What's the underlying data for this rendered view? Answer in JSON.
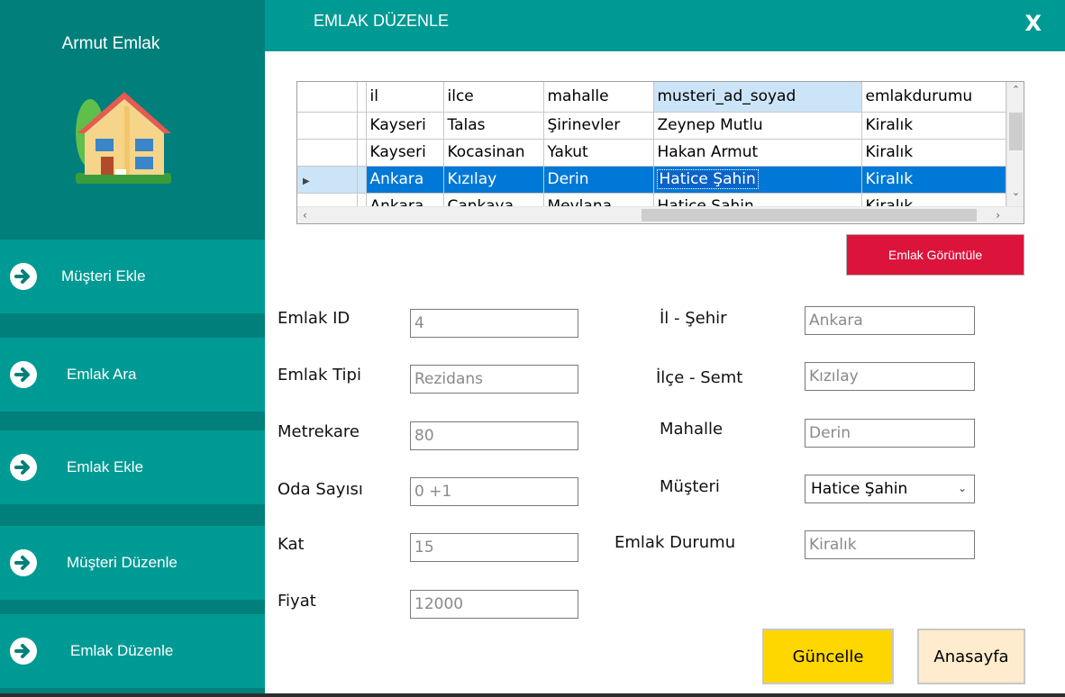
{
  "sidebar": {
    "brand": "Armut Emlak",
    "items": [
      {
        "label": "Müşteri Ekle"
      },
      {
        "label": "Emlak Ara"
      },
      {
        "label": "Emlak Ekle"
      },
      {
        "label": "Müşteri Düzenle"
      },
      {
        "label": "Emlak Düzenle"
      }
    ]
  },
  "header": {
    "title": "EMLAK DÜZENLE",
    "close": "X"
  },
  "grid": {
    "columns": [
      "il",
      "ilce",
      "mahalle",
      "musteri_ad_soyad",
      "emlakdurumu"
    ],
    "rows": [
      [
        "Kayseri",
        "Talas",
        "Şirinevler",
        "Zeynep Mutlu",
        "Kiralık"
      ],
      [
        "Kayseri",
        "Kocasinan",
        "Yakut",
        "Hakan Armut",
        "Kiralık"
      ],
      [
        "Ankara",
        "Kızılay",
        "Derin",
        "Hatice Şahin",
        "Kiralık"
      ],
      [
        "Ankara",
        "Çankaya",
        "Mevlana",
        "Hatice Şahin",
        "Kiralık"
      ]
    ],
    "selected_row": 2
  },
  "buttons": {
    "view": "Emlak Görüntüle",
    "update": "Güncelle",
    "home": "Anasayfa"
  },
  "form": {
    "emlak_id": {
      "label": "Emlak ID",
      "value": "4"
    },
    "emlak_tipi": {
      "label": "Emlak Tipi",
      "value": "Rezidans"
    },
    "metrekare": {
      "label": "Metrekare",
      "value": "80"
    },
    "oda_sayisi": {
      "label": "Oda Sayısı",
      "value": "0 +1"
    },
    "kat": {
      "label": "Kat",
      "value": "15"
    },
    "fiyat": {
      "label": "Fiyat",
      "value": "12000"
    },
    "il": {
      "label": "İl - Şehir",
      "value": "Ankara"
    },
    "ilce": {
      "label": "İlçe - Semt",
      "value": "Kızılay"
    },
    "mahalle": {
      "label": "Mahalle",
      "value": "Derin"
    },
    "musteri": {
      "label": "Müşteri",
      "value": "Hatice Şahin"
    },
    "emlak_durumu": {
      "label": "Emlak Durumu",
      "value": "Kiralık"
    }
  },
  "colors": {
    "sidebar_bg": "#007f7b",
    "accent": "#009a94",
    "view_button": "#dc143c",
    "update_button": "#ffd700",
    "home_button": "#ffebcd",
    "selection": "#0078d7"
  },
  "icons": {
    "logo": "house-icon",
    "nav": "arrow-right-circle-icon",
    "close": "close-icon"
  }
}
